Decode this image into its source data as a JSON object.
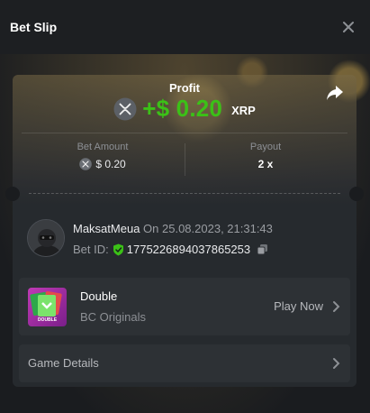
{
  "header": {
    "title": "Bet Slip",
    "close_icon": "close-icon"
  },
  "profit": {
    "label": "Profit",
    "value": "+$ 0.20",
    "currency": "XRP",
    "currency_icon": "xrp-coin-icon",
    "share_icon": "share-icon",
    "value_color": "#3bc117"
  },
  "bet_amount": {
    "label": "Bet Amount",
    "value": "$ 0.20"
  },
  "payout": {
    "label": "Payout",
    "value": "2 x"
  },
  "user": {
    "name": "MaksatMeua",
    "date_text": "On 25.08.2023, 21:31:43",
    "bet_id_label": "Bet ID:",
    "bet_id": "1775226894037865253",
    "verified_icon": "shield-check-icon",
    "copy_icon": "copy-icon"
  },
  "game": {
    "name": "Double",
    "provider": "BC Originals",
    "thumb_text": "DOUBLE",
    "play_label": "Play Now"
  },
  "details": {
    "label": "Game Details"
  }
}
